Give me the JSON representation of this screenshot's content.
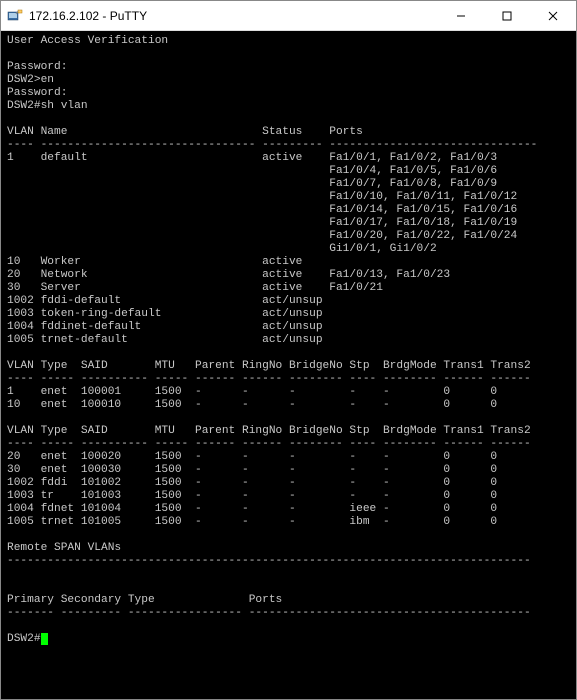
{
  "window": {
    "title": "172.16.2.102 - PuTTY",
    "icon_name": "putty-icon"
  },
  "session": {
    "banner": "User Access Verification",
    "lines_pre": [
      "",
      "Password:",
      "DSW2>en",
      "Password:",
      "DSW2#sh vlan",
      ""
    ],
    "vlan_header": {
      "c1": "VLAN",
      "c2": "Name",
      "c3": "Status",
      "c4": "Ports"
    },
    "vlan_rows": [
      {
        "id": "1",
        "name": "default",
        "status": "active",
        "ports": [
          "Fa1/0/1, Fa1/0/2, Fa1/0/3",
          "Fa1/0/4, Fa1/0/5, Fa1/0/6",
          "Fa1/0/7, Fa1/0/8, Fa1/0/9",
          "Fa1/0/10, Fa1/0/11, Fa1/0/12",
          "Fa1/0/14, Fa1/0/15, Fa1/0/16",
          "Fa1/0/17, Fa1/0/18, Fa1/0/19",
          "Fa1/0/20, Fa1/0/22, Fa1/0/24",
          "Gi1/0/1, Gi1/0/2"
        ]
      },
      {
        "id": "10",
        "name": "Worker",
        "status": "active",
        "ports": [
          ""
        ]
      },
      {
        "id": "20",
        "name": "Network",
        "status": "active",
        "ports": [
          "Fa1/0/13, Fa1/0/23"
        ]
      },
      {
        "id": "30",
        "name": "Server",
        "status": "active",
        "ports": [
          "Fa1/0/21"
        ]
      },
      {
        "id": "1002",
        "name": "fddi-default",
        "status": "act/unsup",
        "ports": [
          ""
        ]
      },
      {
        "id": "1003",
        "name": "token-ring-default",
        "status": "act/unsup",
        "ports": [
          ""
        ]
      },
      {
        "id": "1004",
        "name": "fddinet-default",
        "status": "act/unsup",
        "ports": [
          ""
        ]
      },
      {
        "id": "1005",
        "name": "trnet-default",
        "status": "act/unsup",
        "ports": [
          ""
        ]
      }
    ],
    "detail_header": {
      "c1": "VLAN",
      "c2": "Type",
      "c3": "SAID",
      "c4": "MTU",
      "c5": "Parent",
      "c6": "RingNo",
      "c7": "BridgeNo",
      "c8": "Stp",
      "c9": "BrdgMode",
      "c10": "Trans1",
      "c11": "Trans2"
    },
    "detail_rows_1": [
      {
        "vlan": "1",
        "type": "enet",
        "said": "100001",
        "mtu": "1500",
        "parent": "-",
        "ringno": "-",
        "bridgeno": "-",
        "stp": "-",
        "brdgmode": "-",
        "trans1": "0",
        "trans2": "0"
      },
      {
        "vlan": "10",
        "type": "enet",
        "said": "100010",
        "mtu": "1500",
        "parent": "-",
        "ringno": "-",
        "bridgeno": "-",
        "stp": "-",
        "brdgmode": "-",
        "trans1": "0",
        "trans2": "0"
      }
    ],
    "detail_rows_2": [
      {
        "vlan": "20",
        "type": "enet",
        "said": "100020",
        "mtu": "1500",
        "parent": "-",
        "ringno": "-",
        "bridgeno": "-",
        "stp": "-",
        "brdgmode": "-",
        "trans1": "0",
        "trans2": "0"
      },
      {
        "vlan": "30",
        "type": "enet",
        "said": "100030",
        "mtu": "1500",
        "parent": "-",
        "ringno": "-",
        "bridgeno": "-",
        "stp": "-",
        "brdgmode": "-",
        "trans1": "0",
        "trans2": "0"
      },
      {
        "vlan": "1002",
        "type": "fddi",
        "said": "101002",
        "mtu": "1500",
        "parent": "-",
        "ringno": "-",
        "bridgeno": "-",
        "stp": "-",
        "brdgmode": "-",
        "trans1": "0",
        "trans2": "0"
      },
      {
        "vlan": "1003",
        "type": "tr",
        "said": "101003",
        "mtu": "1500",
        "parent": "-",
        "ringno": "-",
        "bridgeno": "-",
        "stp": "-",
        "brdgmode": "-",
        "trans1": "0",
        "trans2": "0"
      },
      {
        "vlan": "1004",
        "type": "fdnet",
        "said": "101004",
        "mtu": "1500",
        "parent": "-",
        "ringno": "-",
        "bridgeno": "-",
        "stp": "ieee",
        "brdgmode": "-",
        "trans1": "0",
        "trans2": "0"
      },
      {
        "vlan": "1005",
        "type": "trnet",
        "said": "101005",
        "mtu": "1500",
        "parent": "-",
        "ringno": "-",
        "bridgeno": "-",
        "stp": "ibm",
        "brdgmode": "-",
        "trans1": "0",
        "trans2": "0"
      }
    ],
    "rspan_heading": "Remote SPAN VLANs",
    "ps_header": {
      "c1": "Primary",
      "c2": "Secondary",
      "c3": "Type",
      "c4": "Ports"
    },
    "prompt": "DSW2#"
  }
}
